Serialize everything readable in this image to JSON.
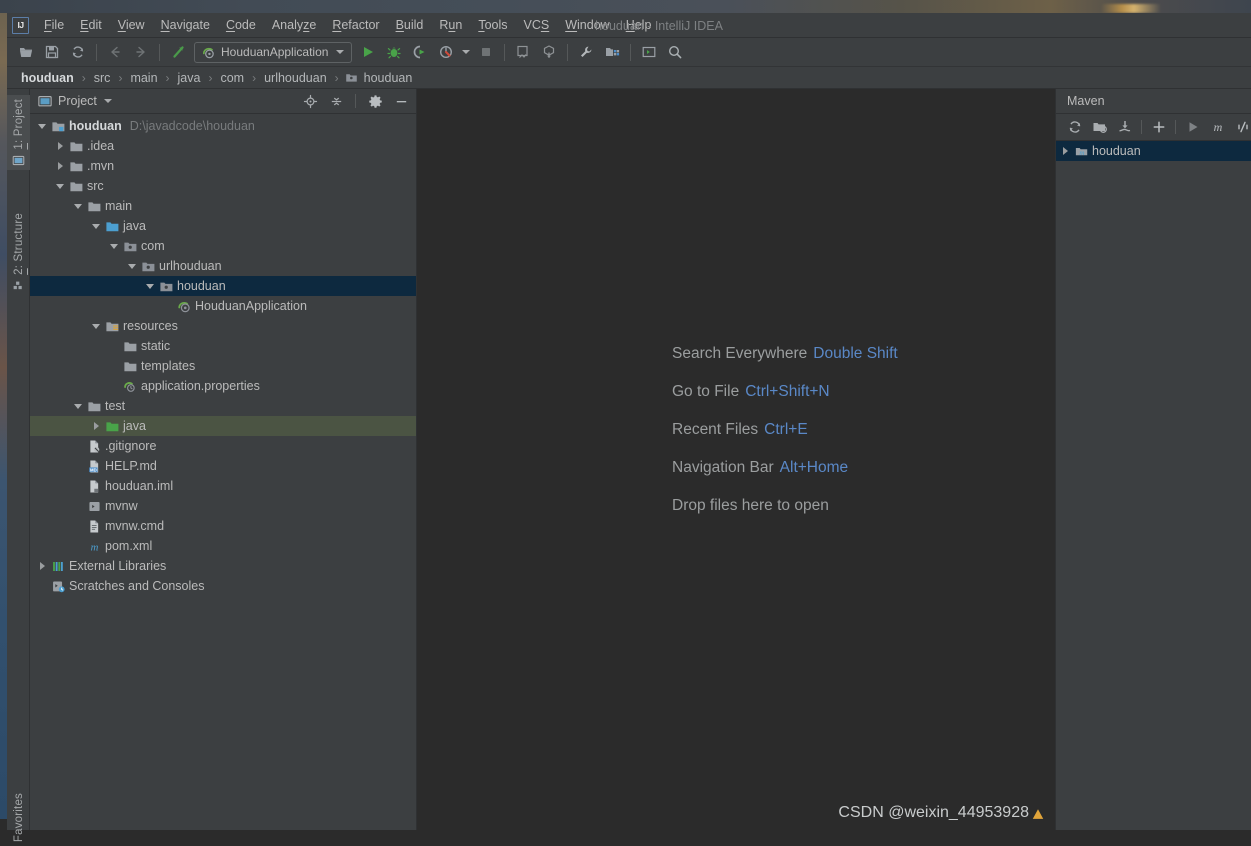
{
  "window": {
    "title": "houduan - IntelliJ IDEA",
    "logo_text": "IJ",
    "accent_blue": "#5a88c7",
    "selection_navy": "#0d293f",
    "selection_green": "#4b5443"
  },
  "menubar": {
    "items": [
      {
        "label": "File",
        "mnemonic": "F"
      },
      {
        "label": "Edit",
        "mnemonic": "E"
      },
      {
        "label": "View",
        "mnemonic": "V"
      },
      {
        "label": "Navigate",
        "mnemonic": "N"
      },
      {
        "label": "Code",
        "mnemonic": "C"
      },
      {
        "label": "Analyze",
        "mnemonic": "z"
      },
      {
        "label": "Refactor",
        "mnemonic": "R"
      },
      {
        "label": "Build",
        "mnemonic": "B"
      },
      {
        "label": "Run",
        "mnemonic": "u"
      },
      {
        "label": "Tools",
        "mnemonic": "T"
      },
      {
        "label": "VCS",
        "mnemonic": "S"
      },
      {
        "label": "Window",
        "mnemonic": "W"
      },
      {
        "label": "Help",
        "mnemonic": "H"
      }
    ]
  },
  "toolbar": {
    "open_label": "Open",
    "save_label": "Save All",
    "sync_label": "Synchronize",
    "back_label": "Back",
    "forward_label": "Forward",
    "edit_source_label": "Edit Source",
    "run_config": "HouduanApplication",
    "run_label": "Run",
    "debug_label": "Debug",
    "run_coverage_label": "Run with Coverage",
    "profile_label": "Profile",
    "stop_label": "Stop",
    "commit_label": "Commit",
    "update_label": "Update Project",
    "settings_label": "Settings",
    "project_structure_label": "Project Structure",
    "terminal_label": "Terminal",
    "search_label": "Search Everywhere"
  },
  "breadcrumb": {
    "separator": "›",
    "items": [
      {
        "label": "houduan",
        "icon": null
      },
      {
        "label": "src",
        "icon": null
      },
      {
        "label": "main",
        "icon": null
      },
      {
        "label": "java",
        "icon": null
      },
      {
        "label": "com",
        "icon": null
      },
      {
        "label": "urlhouduan",
        "icon": null
      },
      {
        "label": "houduan",
        "icon": "package-icon"
      }
    ]
  },
  "left_strip": {
    "tabs": [
      {
        "label": "1: Project",
        "mnemonic": "1",
        "icon": "project-icon",
        "active": true
      },
      {
        "label": "2: Structure",
        "mnemonic": "2",
        "icon": "structure-icon",
        "active": false
      },
      {
        "label": "Favorites",
        "mnemonic": "",
        "icon": "favorites-icon",
        "active": false
      }
    ]
  },
  "project_panel": {
    "title": "Project",
    "buttons": [
      {
        "name": "locate-icon",
        "label": "Select Opened File"
      },
      {
        "name": "collapse-all-icon",
        "label": "Collapse All"
      },
      {
        "name": "gear-icon",
        "label": "Settings"
      },
      {
        "name": "minimize-icon",
        "label": "Hide"
      }
    ],
    "tree": [
      {
        "label": "houduan",
        "path": "D:\\javadcode\\houduan",
        "indent": 0,
        "arrow": "down",
        "icon": "module-icon",
        "bold": true,
        "state": "normal"
      },
      {
        "label": ".idea",
        "path": "",
        "indent": 1,
        "arrow": "right",
        "icon": "folder-icon",
        "bold": false,
        "state": "normal"
      },
      {
        "label": ".mvn",
        "path": "",
        "indent": 1,
        "arrow": "right",
        "icon": "folder-icon",
        "bold": false,
        "state": "normal"
      },
      {
        "label": "src",
        "path": "",
        "indent": 1,
        "arrow": "down",
        "icon": "folder-icon",
        "bold": false,
        "state": "normal"
      },
      {
        "label": "main",
        "path": "",
        "indent": 2,
        "arrow": "down",
        "icon": "folder-icon",
        "bold": false,
        "state": "normal"
      },
      {
        "label": "java",
        "path": "",
        "indent": 3,
        "arrow": "down",
        "icon": "source-root-icon",
        "bold": false,
        "state": "normal"
      },
      {
        "label": "com",
        "path": "",
        "indent": 4,
        "arrow": "down",
        "icon": "package-icon",
        "bold": false,
        "state": "normal"
      },
      {
        "label": "urlhouduan",
        "path": "",
        "indent": 5,
        "arrow": "down",
        "icon": "package-icon",
        "bold": false,
        "state": "normal"
      },
      {
        "label": "houduan",
        "path": "",
        "indent": 6,
        "arrow": "down",
        "icon": "package-icon",
        "bold": false,
        "state": "selected"
      },
      {
        "label": "HouduanApplication",
        "path": "",
        "indent": 7,
        "arrow": "none",
        "icon": "spring-class-icon",
        "bold": false,
        "state": "normal"
      },
      {
        "label": "resources",
        "path": "",
        "indent": 3,
        "arrow": "down",
        "icon": "resource-root-icon",
        "bold": false,
        "state": "normal"
      },
      {
        "label": "static",
        "path": "",
        "indent": 4,
        "arrow": "none",
        "icon": "folder-icon",
        "bold": false,
        "state": "normal"
      },
      {
        "label": "templates",
        "path": "",
        "indent": 4,
        "arrow": "none",
        "icon": "folder-icon",
        "bold": false,
        "state": "normal"
      },
      {
        "label": "application.properties",
        "path": "",
        "indent": 4,
        "arrow": "none",
        "icon": "spring-properties-icon",
        "bold": false,
        "state": "normal"
      },
      {
        "label": "test",
        "path": "",
        "indent": 2,
        "arrow": "down",
        "icon": "folder-icon",
        "bold": false,
        "state": "normal"
      },
      {
        "label": "java",
        "path": "",
        "indent": 3,
        "arrow": "right",
        "icon": "test-source-root-icon",
        "bold": false,
        "state": "hover"
      },
      {
        "label": ".gitignore",
        "path": "",
        "indent": 2,
        "arrow": "none",
        "icon": "gitignore-file-icon",
        "bold": false,
        "state": "normal"
      },
      {
        "label": "HELP.md",
        "path": "",
        "indent": 2,
        "arrow": "none",
        "icon": "markdown-file-icon",
        "bold": false,
        "state": "normal"
      },
      {
        "label": "houduan.iml",
        "path": "",
        "indent": 2,
        "arrow": "none",
        "icon": "iml-file-icon",
        "bold": false,
        "state": "normal"
      },
      {
        "label": "mvnw",
        "path": "",
        "indent": 2,
        "arrow": "none",
        "icon": "shell-file-icon",
        "bold": false,
        "state": "normal"
      },
      {
        "label": "mvnw.cmd",
        "path": "",
        "indent": 2,
        "arrow": "none",
        "icon": "cmd-file-icon",
        "bold": false,
        "state": "normal"
      },
      {
        "label": "pom.xml",
        "path": "",
        "indent": 2,
        "arrow": "none",
        "icon": "maven-file-icon",
        "bold": false,
        "state": "normal"
      },
      {
        "label": "External Libraries",
        "path": "",
        "indent": 0,
        "arrow": "right",
        "icon": "libraries-icon",
        "bold": false,
        "state": "normal"
      },
      {
        "label": "Scratches and Consoles",
        "path": "",
        "indent": 0,
        "arrow": "none",
        "icon": "scratches-icon",
        "bold": false,
        "state": "normal"
      }
    ]
  },
  "editor": {
    "hints": [
      {
        "action": "Search Everywhere",
        "shortcut": "Double Shift"
      },
      {
        "action": "Go to File",
        "shortcut": "Ctrl+Shift+N"
      },
      {
        "action": "Recent Files",
        "shortcut": "Ctrl+E"
      },
      {
        "action": "Navigation Bar",
        "shortcut": "Alt+Home"
      },
      {
        "action": "Drop files here to open",
        "shortcut": ""
      }
    ],
    "watermark": "CSDN @weixin_44953928"
  },
  "maven_panel": {
    "title": "Maven",
    "buttons": [
      {
        "name": "reload-icon",
        "label": "Reload All Maven Projects"
      },
      {
        "name": "generate-sources-icon",
        "label": "Generate Sources and Update Folders"
      },
      {
        "name": "download-sources-icon",
        "label": "Download Sources"
      },
      {
        "name": "add-icon",
        "label": "Add Maven Project"
      },
      {
        "name": "run-icon",
        "label": "Run Maven Build"
      },
      {
        "name": "maven-m-icon",
        "label": "Execute Maven Goal"
      },
      {
        "name": "toggle-skip-tests-icon",
        "label": "Toggle Skip Tests Mode"
      }
    ],
    "tree": [
      {
        "label": "houduan",
        "arrow": "right",
        "icon": "maven-project-icon",
        "state": "selected"
      }
    ]
  }
}
